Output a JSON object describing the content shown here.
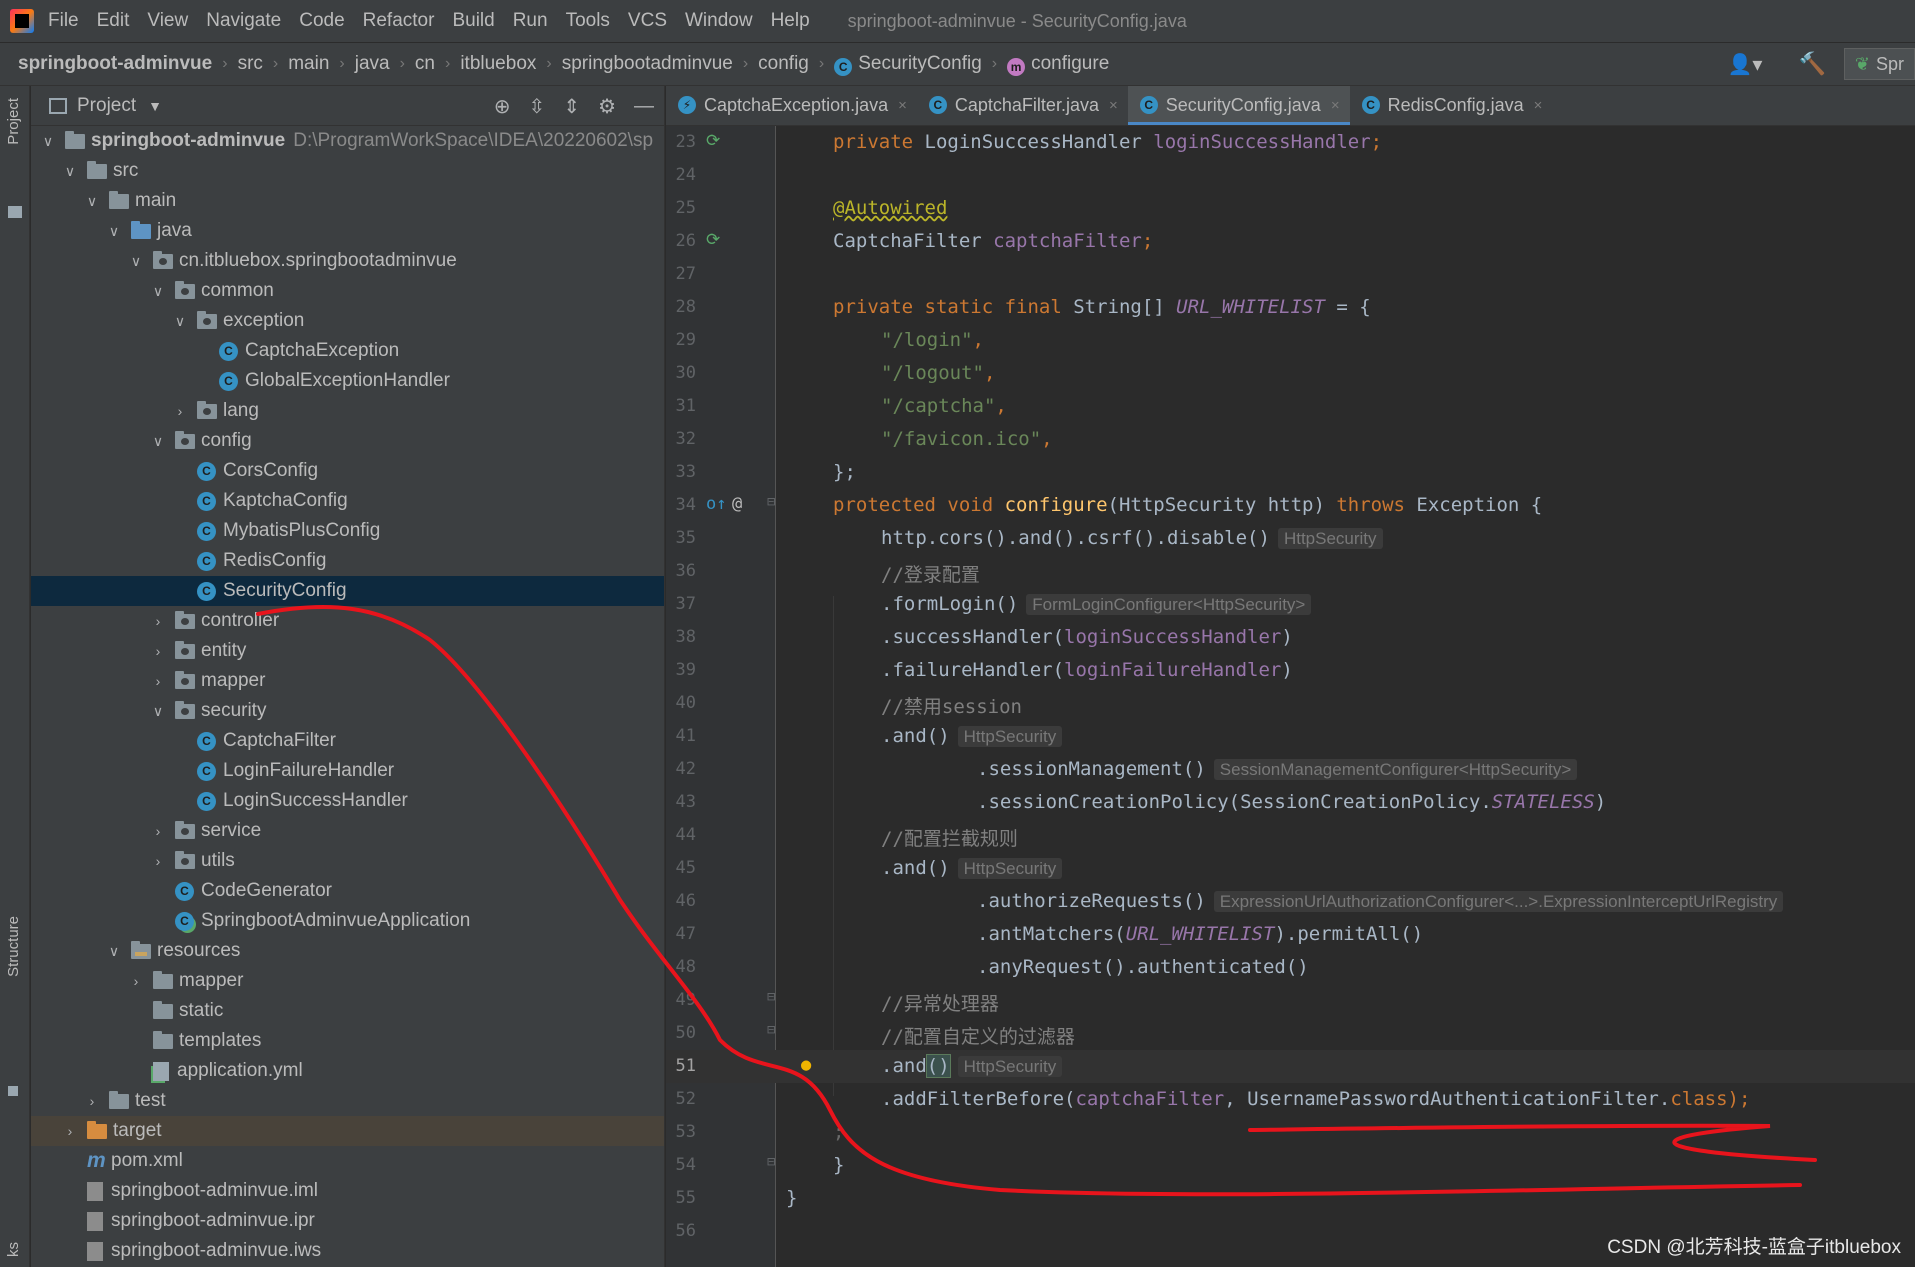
{
  "menubar": {
    "items": [
      {
        "label": "File"
      },
      {
        "label": "Edit"
      },
      {
        "label": "View"
      },
      {
        "label": "Navigate"
      },
      {
        "label": "Code"
      },
      {
        "label": "Refactor"
      },
      {
        "label": "Build"
      },
      {
        "label": "Run"
      },
      {
        "label": "Tools"
      },
      {
        "label": "VCS"
      },
      {
        "label": "Window"
      },
      {
        "label": "Help"
      }
    ],
    "window_title": "springboot-adminvue - SecurityConfig.java"
  },
  "breadcrumb": {
    "items": [
      "springboot-adminvue",
      "src",
      "main",
      "java",
      "cn",
      "itbluebox",
      "springbootadminvue",
      "config",
      "SecurityConfig",
      "configure"
    ],
    "run_config": "Spr"
  },
  "left_strip": {
    "project_tab": "Project",
    "structure_tab": "Structure",
    "bookmarks_tab": "ks"
  },
  "project_panel": {
    "title": "Project",
    "tree": [
      {
        "label": "springboot-adminvue",
        "path": "D:\\ProgramWorkSpace\\IDEA\\20220602\\sp"
      },
      {
        "label": "src"
      },
      {
        "label": "main"
      },
      {
        "label": "java"
      },
      {
        "label": "cn.itbluebox.springbootadminvue"
      },
      {
        "label": "common"
      },
      {
        "label": "exception"
      },
      {
        "label": "CaptchaException"
      },
      {
        "label": "GlobalExceptionHandler"
      },
      {
        "label": "lang"
      },
      {
        "label": "config"
      },
      {
        "label": "CorsConfig"
      },
      {
        "label": "KaptchaConfig"
      },
      {
        "label": "MybatisPlusConfig"
      },
      {
        "label": "RedisConfig"
      },
      {
        "label": "SecurityConfig"
      },
      {
        "label": "controller"
      },
      {
        "label": "entity"
      },
      {
        "label": "mapper"
      },
      {
        "label": "security"
      },
      {
        "label": "CaptchaFilter"
      },
      {
        "label": "LoginFailureHandler"
      },
      {
        "label": "LoginSuccessHandler"
      },
      {
        "label": "service"
      },
      {
        "label": "utils"
      },
      {
        "label": "CodeGenerator"
      },
      {
        "label": "SpringbootAdminvueApplication"
      },
      {
        "label": "resources"
      },
      {
        "label": "mapper"
      },
      {
        "label": "static"
      },
      {
        "label": "templates"
      },
      {
        "label": "application.yml"
      },
      {
        "label": "test"
      },
      {
        "label": "target"
      },
      {
        "label": "pom.xml"
      },
      {
        "label": "springboot-adminvue.iml"
      },
      {
        "label": "springboot-adminvue.ipr"
      },
      {
        "label": "springboot-adminvue.iws"
      }
    ]
  },
  "editor": {
    "tabs": [
      {
        "label": "CaptchaException.java",
        "close": "×"
      },
      {
        "label": "CaptchaFilter.java",
        "close": "×"
      },
      {
        "label": "SecurityConfig.java",
        "close": "×"
      },
      {
        "label": "RedisConfig.java",
        "close": "×"
      }
    ],
    "active_tab": "SecurityConfig.java",
    "current_line": 51,
    "code": {
      "l23": {
        "n": "23",
        "a": "private",
        "b": " LoginSuccessHandler ",
        "c": "loginSuccessHandler",
        "d": ";"
      },
      "l24": {
        "n": "24"
      },
      "l25": {
        "n": "25",
        "a": "@Autowired"
      },
      "l26": {
        "n": "26",
        "a": "CaptchaFilter ",
        "b": "captchaFilter",
        "c": ";"
      },
      "l27": {
        "n": "27"
      },
      "l28": {
        "n": "28",
        "a": "private static final ",
        "b": "String[] ",
        "c": "URL_WHITELIST",
        "d": " = {"
      },
      "l29": {
        "n": "29",
        "a": "\"/login\"",
        "b": ","
      },
      "l30": {
        "n": "30",
        "a": "\"/logout\"",
        "b": ","
      },
      "l31": {
        "n": "31",
        "a": "\"/captcha\"",
        "b": ","
      },
      "l32": {
        "n": "32",
        "a": "\"/favicon.ico\"",
        "b": ","
      },
      "l33": {
        "n": "33",
        "a": "};"
      },
      "l34": {
        "n": "34",
        "a": "protected void ",
        "b": "configure",
        "c": "(HttpSecurity http) ",
        "d": "throws ",
        "e": "Exception {"
      },
      "l35": {
        "n": "35",
        "a": "http.cors().and().csrf().disable()",
        "h": "HttpSecurity"
      },
      "l36": {
        "n": "36",
        "a": "//登录配置"
      },
      "l37": {
        "n": "37",
        "a": ".formLogin()",
        "h": "FormLoginConfigurer<HttpSecurity>"
      },
      "l38": {
        "n": "38",
        "a": ".successHandler(",
        "b": "loginSuccessHandler",
        "c": ")"
      },
      "l39": {
        "n": "39",
        "a": ".failureHandler(",
        "b": "loginFailureHandler",
        "c": ")"
      },
      "l40": {
        "n": "40",
        "a": "//禁用session"
      },
      "l41": {
        "n": "41",
        "a": ".and()",
        "h": "HttpSecurity"
      },
      "l42": {
        "n": "42",
        "a": ".sessionManagement()",
        "h": "SessionManagementConfigurer<HttpSecurity>"
      },
      "l43": {
        "n": "43",
        "a": ".sessionCreationPolicy(SessionCreationPolicy.",
        "b": "STATELESS",
        "c": ")"
      },
      "l44": {
        "n": "44",
        "a": "//配置拦截规则"
      },
      "l45": {
        "n": "45",
        "a": ".and()",
        "h": "HttpSecurity"
      },
      "l46": {
        "n": "46",
        "a": ".authorizeRequests()",
        "h": "ExpressionUrlAuthorizationConfigurer<...>.ExpressionInterceptUrlRegistry"
      },
      "l47": {
        "n": "47",
        "a": ".antMatchers(",
        "b": "URL_WHITELIST",
        "c": ").permitAll()"
      },
      "l48": {
        "n": "48",
        "a": ".anyRequest().authenticated()"
      },
      "l49": {
        "n": "49",
        "a": "//异常处理器"
      },
      "l50": {
        "n": "50",
        "a": "//配置自定义的过滤器"
      },
      "l51": {
        "n": "51",
        "a": ".and",
        "b": "()",
        "h": "HttpSecurity"
      },
      "l52": {
        "n": "52",
        "a": ".addFilterBefore(",
        "b": "captchaFilter",
        "c": ", UsernamePasswordAuthenticationFilter.",
        "d": "class",
        "e": ");"
      },
      "l53": {
        "n": "53",
        "a": ";"
      },
      "l54": {
        "n": "54",
        "a": "}"
      },
      "l55": {
        "n": "55",
        "a": "}"
      },
      "l56": {
        "n": "56"
      }
    }
  },
  "icons": {
    "class_letter": "C",
    "method_letter": "m",
    "maven_letter": "m",
    "annotation_gutter": "@"
  },
  "colors": {
    "annotation_stroke": "#e8141c",
    "selection": "#0d293e",
    "accent_tab": "#4a88c7"
  },
  "watermark": "CSDN @北芳科技-蓝盒子itbluebox"
}
